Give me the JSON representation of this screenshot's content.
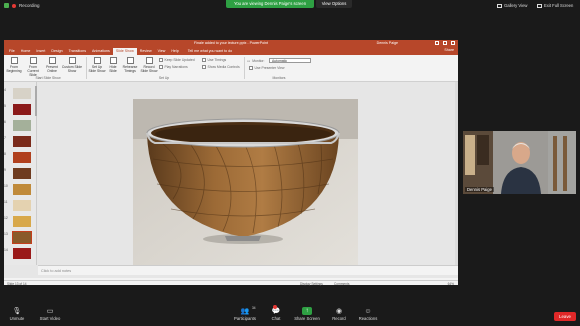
{
  "zoom": {
    "recording_label": "Recording",
    "share_banner": "You are viewing Dennis Paige's screen",
    "view_options": "View Options",
    "gallery_view": "Gallery View",
    "exit_full_screen": "Exit Full Screen"
  },
  "ppt": {
    "title": "Finale added to your lecture.pptx - PowerPoint",
    "user": "Dennis Paige",
    "tabs": [
      "File",
      "Home",
      "Insert",
      "Design",
      "Transitions",
      "Animations",
      "Slide Show",
      "Review",
      "View",
      "Help"
    ],
    "active_tab": "Slide Show",
    "tell_me": "Tell me what you want to do",
    "share": "Share",
    "ribbon": {
      "from_beginning": "From Beginning",
      "from_current": "From Current Slide",
      "present_online": "Present Online",
      "custom_show": "Custom Slide Show",
      "group_start": "Start Slide Show",
      "setup": "Set Up Slide Show",
      "hide_slide": "Hide Slide",
      "rehearse": "Rehearse Timings",
      "record": "Record Slide Show",
      "keep_narrations": "Keep Slide Updated",
      "play_narrations": "Play Narrations",
      "use_timings": "Use Timings",
      "show_media": "Show Media Controls",
      "group_setup": "Set Up",
      "monitor_label": "Monitor:",
      "monitor_value": "Automatic",
      "presenter_view": "Use Presenter View",
      "group_monitors": "Monitors"
    },
    "slide_numbers": [
      "4",
      "5",
      "6",
      "7",
      "8",
      "9",
      "10",
      "11",
      "12",
      "13",
      "14"
    ],
    "selected_slide": "13",
    "notes_placeholder": "Click to add notes",
    "status": {
      "slide": "Slide 13 of 14",
      "display_settings": "Display Settings",
      "comments": "Comments",
      "zoom": "64%"
    }
  },
  "participant": {
    "name": "Dennis Paige"
  },
  "toolbar": {
    "unmute": "Unmute",
    "start_video": "Start Video",
    "participants": "Participants",
    "participants_count": "34",
    "chat": "Chat",
    "share_screen": "Share Screen",
    "record": "Record",
    "reactions": "Reactions",
    "leave": "Leave"
  },
  "colors": {
    "ppt_accent": "#b7472a",
    "share_green": "#2ea043",
    "leave_red": "#e02828"
  }
}
